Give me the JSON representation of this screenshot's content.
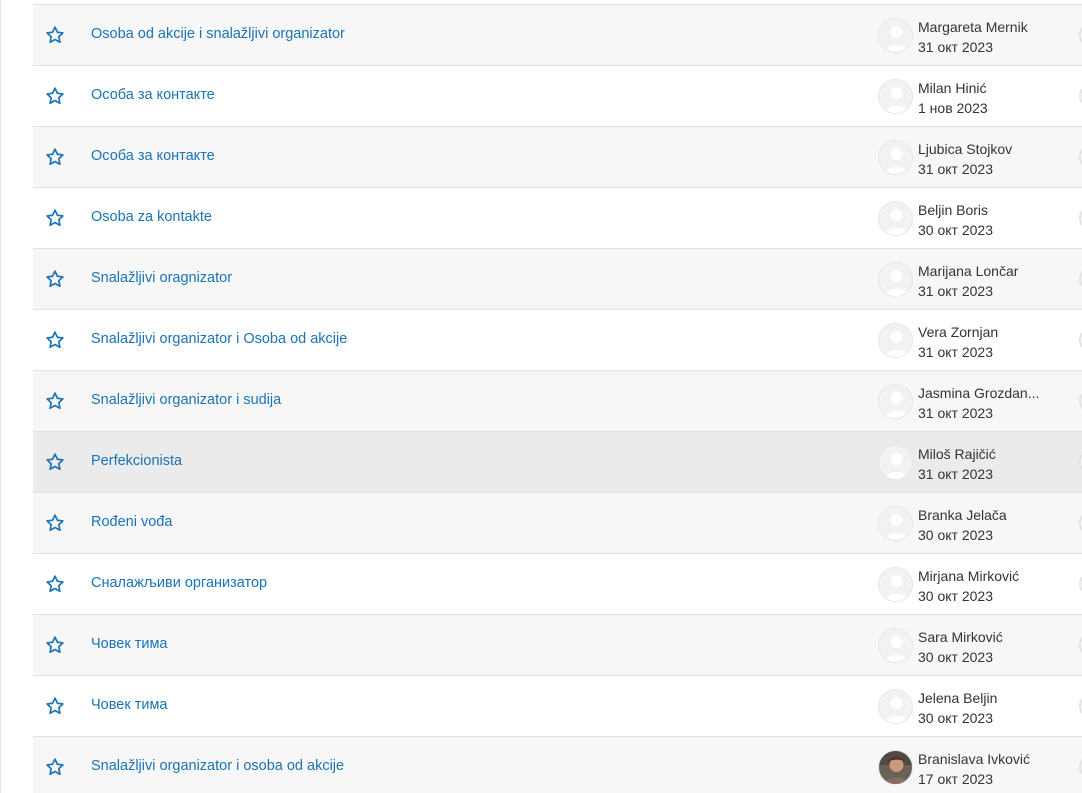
{
  "discussions": [
    {
      "title": "Osoba od akcije i snalažljivi organizator",
      "author": "Margareta Mernik",
      "date": "31 окт 2023",
      "avatar": "default"
    },
    {
      "title": "Особа за контакте",
      "author": "Milan Hinić",
      "date": "1 нов 2023",
      "avatar": "default"
    },
    {
      "title": "Особа за контакте",
      "author": "Ljubica Stojkov",
      "date": "31 окт 2023",
      "avatar": "default"
    },
    {
      "title": "Osoba za kontakte",
      "author": "Beljin Boris",
      "date": "30 окт 2023",
      "avatar": "default"
    },
    {
      "title": "Snalažljivi oragnizator",
      "author": "Marijana Lončar",
      "date": "31 окт 2023",
      "avatar": "default"
    },
    {
      "title": "Snalažljivi organizator i Osoba od akcije",
      "author": "Vera Zornjan",
      "date": "31 окт 2023",
      "avatar": "default"
    },
    {
      "title": "Snalažljivi organizator i sudija",
      "author": "Jasmina Grozdan...",
      "date": "31 окт 2023",
      "avatar": "default"
    },
    {
      "title": "Perfekcionista",
      "author": "Miloš Rajičić",
      "date": "31 окт 2023",
      "avatar": "default"
    },
    {
      "title": "Rođeni vođa",
      "author": "Branka Jelača",
      "date": "30 окт 2023",
      "avatar": "default"
    },
    {
      "title": "Сналажљиви организатор",
      "author": "Mirjana Mirković",
      "date": "30 окт 2023",
      "avatar": "default"
    },
    {
      "title": "Човек тима",
      "author": "Sara Mirković",
      "date": "30 окт 2023",
      "avatar": "default"
    },
    {
      "title": "Човек тима",
      "author": "Jelena Beljin",
      "date": "30 окт 2023",
      "avatar": "default"
    },
    {
      "title": "Snalažljivi organizator i osoba od akcije",
      "author": "Branislava Ivković",
      "date": "17 окт 2023",
      "avatar": "photo"
    }
  ],
  "hovered_row": 7,
  "icons": {
    "star": "star-outline-icon",
    "avatar": "user-avatar-icon"
  },
  "colors": {
    "link": "#1a73b6",
    "star": "#1a73b6",
    "row_alt": "#f7f7f7",
    "row_hover": "#ebebeb",
    "border": "#dee2e6"
  }
}
